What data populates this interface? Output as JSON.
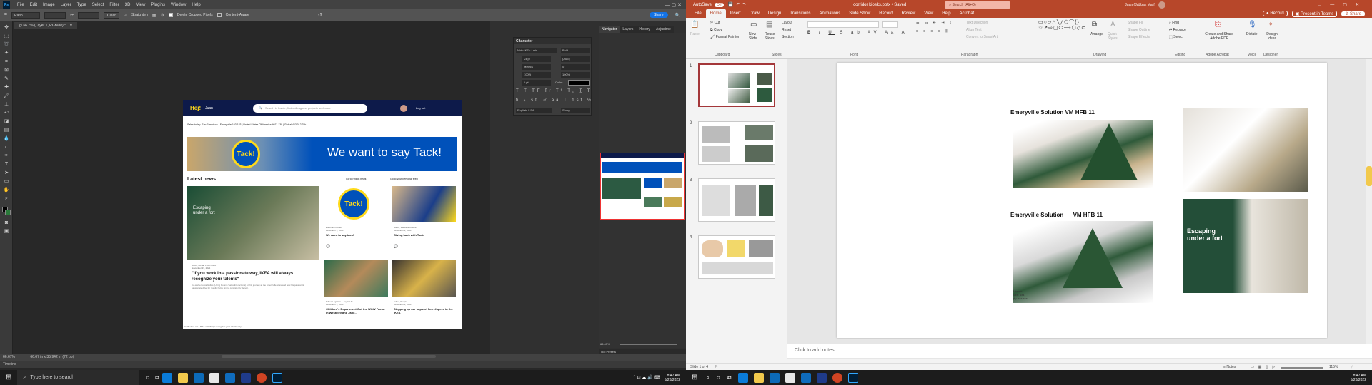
{
  "ps": {
    "logo": "Ps",
    "menus": [
      "File",
      "Edit",
      "Image",
      "Layer",
      "Type",
      "Select",
      "Filter",
      "3D",
      "View",
      "Plugins",
      "Window",
      "Help"
    ],
    "options": {
      "ratio": "Ratio",
      "clear": "Clear",
      "straighten": "Straighten",
      "delete_cropped": "Delete Cropped Pixels",
      "content_aware": "Content-Aware",
      "share": "Share"
    },
    "doc_tab": "@ 66.7% (Layer 1, RGB/8#) *",
    "panel_tabs": [
      "Navigator",
      "Layers",
      "History",
      "Adjustme"
    ],
    "character": {
      "title": "Character",
      "font": "Noto IKEA Latin",
      "style": "Bold",
      "size": "24 pt",
      "leading": "(Auto)",
      "kerning": "Metrics",
      "tracking": "0",
      "scale_v": "100%",
      "scale_h": "100%",
      "baseline": "0 pt",
      "color_label": "Color:",
      "language": "English: USA",
      "aa": "Sharp"
    },
    "nav_zoom": "66.67%",
    "tool_presets": "Tool Presets",
    "libraries": "Libraries",
    "status_zoom": "66.67%",
    "status_size": "66.67 in x 35.942 in (72 ppi)",
    "timeline": "Timeline"
  },
  "ikea": {
    "logo": "Hej!",
    "user": "Juan",
    "search_placeholder": "Search in Inside, find colleagues, projects and more",
    "logout": "Log out",
    "info": "Sales today: San Francisco - Emeryville  103,183  |  United States Of America  4071.13k  |  Global  463,012.33k",
    "banner_badge": "Tack!",
    "banner_text": "We want to say Tack!",
    "latest": "Latest news",
    "link1": "Go to region news",
    "link2": "Go to your personal feed",
    "big_card_text": "Escaping under a fort",
    "cards": [
      {
        "meta": "Editorial, People\nDecember 1, 2021",
        "title": "We want to say tack!"
      },
      {
        "meta": "Editor, Values & Culture\nDecember 1, 2021",
        "title": "Giving back with Tack!"
      },
      {
        "meta": "Editor, Logistics + Joy in Life\nDecember 1, 2021",
        "title": "Children's Department Got the WOW Factor in Westeley and Jane..."
      },
      {
        "meta": "Editor, People\nDecember 1, 2021",
        "title": "Stepping up our support for refugees in the IKEA"
      }
    ],
    "quote_meta": "Editor, Co-lab + Get IKEA\nNovember 23, 2021",
    "quote": "\"If you work in a passionate way, IKEA will always recognize your talents\"",
    "quote_body": "Co-worker Luca Gollos (Living Rooms Sales Interactions) on his journey at the Emeryville store and how his passion & passionate drive for results helps him to consistently deliver.",
    "footer": "inside.ikea.net - IKEA will always recognize your talents' says..."
  },
  "ppt": {
    "autosave": "AutoSave",
    "autosave_state": "Off",
    "filename": "corridor kiosks.pptx  •  Saved",
    "search": "Search (Alt+Q)",
    "user": "Juan (Jabbaz Mari)",
    "tabs": [
      "File",
      "Home",
      "Insert",
      "Draw",
      "Design",
      "Transitions",
      "Animations",
      "Slide Show",
      "Record",
      "Review",
      "View",
      "Help",
      "Acrobat"
    ],
    "record": "Record",
    "present": "Present in Teams",
    "share": "Share",
    "ribbon": {
      "clipboard": "Clipboard",
      "paste": "Paste",
      "cut": "Cut",
      "copy": "Copy",
      "format_painter": "Format Painter",
      "slides": "Slides",
      "new_slide": "New Slide",
      "reuse": "Reuse Slides",
      "layout": "Layout",
      "reset": "Reset",
      "section": "Section",
      "font": "Font",
      "paragraph": "Paragraph",
      "text_direction": "Text Direction",
      "align_text": "Align Text",
      "convert_smartart": "Convert to SmartArt",
      "drawing": "Drawing",
      "arrange": "Arrange",
      "quick_styles": "Quick Styles",
      "shape_fill": "Shape Fill",
      "shape_outline": "Shape Outline",
      "shape_effects": "Shape Effects",
      "editing": "Editing",
      "find": "Find",
      "replace": "Replace",
      "select": "Select",
      "adobe": "Adobe Acrobat",
      "create_pdf": "Create and Share Adobe PDF",
      "voice": "Voice",
      "dictate": "Dictate",
      "designer": "Designer",
      "design_ideas": "Design Ideas"
    },
    "thumb_numbers": [
      "1",
      "2",
      "3",
      "4"
    ],
    "slide": {
      "title1": "Emeryville Solution VM HFB 11",
      "title2": "Emeryville Solution      VM HFB 11",
      "photo_text": "Escaping under a fort",
      "caption": "Artwork\nSize: 4x4\nqty: xxx xxx"
    },
    "notes": "Click to add notes",
    "status_slide": "Slide 1 of 4",
    "status_notes": "Notes",
    "status_zoom": "115%"
  },
  "taskbar": {
    "search": "Type here to search",
    "time": "8:47 AM",
    "date": "5/23/2022"
  },
  "colors": {
    "ps_bg": "#282828",
    "ikea_blue": "#0051ba",
    "ikea_yellow": "#ffda1a",
    "ppt_red": "#b7472a"
  }
}
